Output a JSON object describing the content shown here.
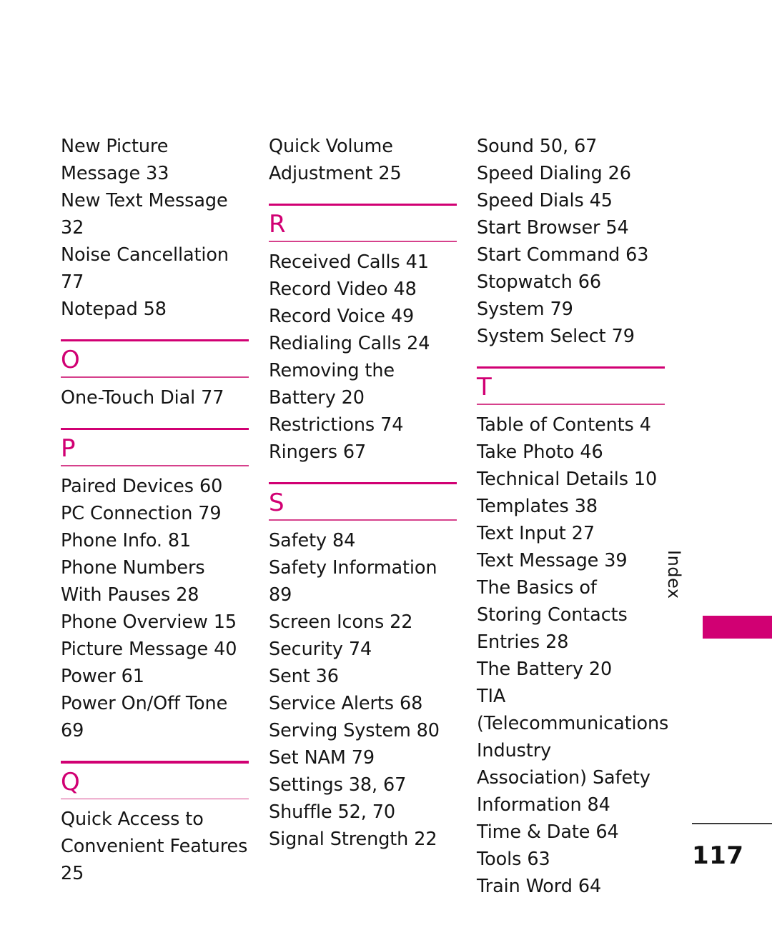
{
  "page": {
    "number": "117",
    "side_tab_label": "Index",
    "accent_color": "#D10073",
    "rule_color_light": "#D6418C",
    "text_color": "#151515"
  },
  "columns": [
    {
      "blocks": [
        {
          "kind": "entries",
          "items": [
            "New Picture Message 33",
            "New Text Message 32",
            "Noise Cancellation 77",
            "Notepad 58"
          ]
        },
        {
          "kind": "section",
          "letter": "O"
        },
        {
          "kind": "entries",
          "items": [
            "One-Touch Dial 77"
          ]
        },
        {
          "kind": "section",
          "letter": "P"
        },
        {
          "kind": "entries",
          "items": [
            "Paired Devices 60",
            "PC Connection 79",
            "Phone Info. 81",
            "Phone Numbers With Pauses 28",
            "Phone Overview 15",
            "Picture Message 40",
            "Power 61",
            "Power On/Off Tone 69"
          ]
        },
        {
          "kind": "section",
          "letter": "Q"
        },
        {
          "kind": "entries",
          "items": [
            "Quick Access to Convenient Features 25"
          ]
        }
      ]
    },
    {
      "blocks": [
        {
          "kind": "entries",
          "items": [
            "Quick Volume Adjustment 25"
          ]
        },
        {
          "kind": "section",
          "letter": "R"
        },
        {
          "kind": "entries",
          "items": [
            "Received Calls 41",
            "Record Video 48",
            "Record Voice 49",
            "Redialing Calls 24",
            "Removing the Battery 20",
            "Restrictions 74",
            "Ringers 67"
          ]
        },
        {
          "kind": "section",
          "letter": "S"
        },
        {
          "kind": "entries",
          "items": [
            "Safety 84",
            "Safety Information 89",
            "Screen Icons 22",
            "Security 74",
            "Sent 36",
            "Service Alerts 68",
            "Serving System 80",
            "Set NAM 79",
            "Settings 38, 67",
            "Shuffle 52, 70",
            "Signal Strength 22"
          ]
        }
      ]
    },
    {
      "blocks": [
        {
          "kind": "entries",
          "items": [
            "Sound 50, 67",
            "Speed Dialing 26",
            "Speed Dials 45",
            "Start Browser 54",
            "Start Command 63",
            "Stopwatch 66",
            "System 79",
            "System Select 79"
          ]
        },
        {
          "kind": "section",
          "letter": "T"
        },
        {
          "kind": "entries",
          "items": [
            "Table of Contents 4",
            "Take Photo 46",
            "Technical Details 10",
            "Templates 38",
            "Text Input 27",
            "Text Message 39",
            "The Basics of Storing Contacts Entries 28",
            "The Battery 20",
            "TIA (Telecommunications Industry Association) Safety Information 84",
            "Time & Date 64",
            "Tools 63",
            "Train Word 64"
          ]
        }
      ]
    }
  ]
}
